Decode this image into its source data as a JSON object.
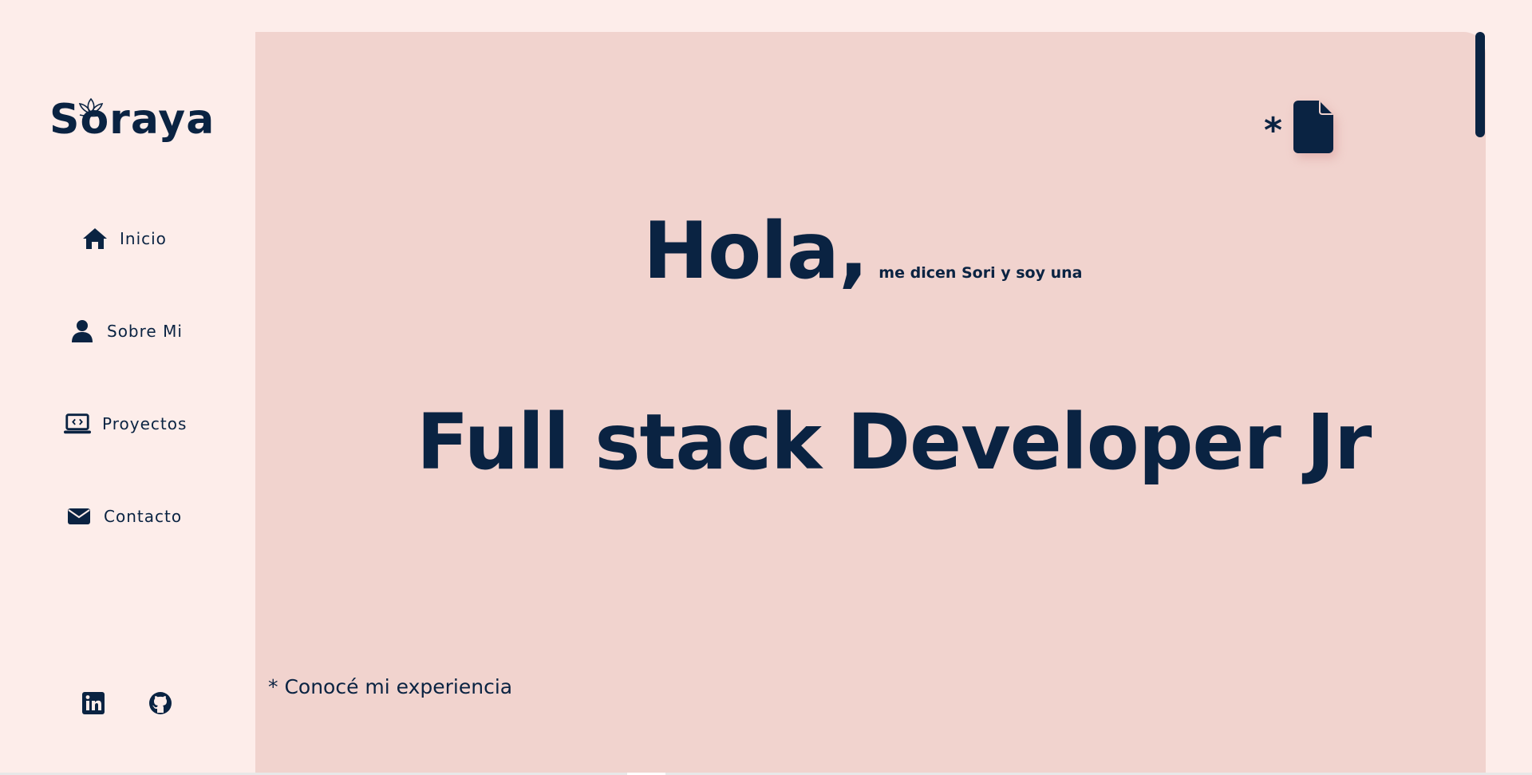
{
  "brand": {
    "name": "Soraya"
  },
  "nav": {
    "items": [
      {
        "label": "Inicio",
        "icon": "home-icon"
      },
      {
        "label": "Sobre Mi",
        "icon": "user-icon"
      },
      {
        "label": "Proyectos",
        "icon": "laptop-code-icon"
      },
      {
        "label": "Contacto",
        "icon": "envelope-icon"
      }
    ]
  },
  "social": {
    "items": [
      {
        "icon": "linkedin-icon"
      },
      {
        "icon": "github-icon"
      }
    ]
  },
  "hero": {
    "asterisk": "*",
    "greeting": "Hola,",
    "intro": "me dicen Sori y soy una",
    "role": "Full stack Developer Jr",
    "footnote": "* Conocé mi experiencia",
    "cv_icon": "file-icon"
  },
  "colors": {
    "navy": "#0a2342",
    "sidebar_bg": "#fdedea",
    "panel_bg": "#f1d3ce"
  }
}
